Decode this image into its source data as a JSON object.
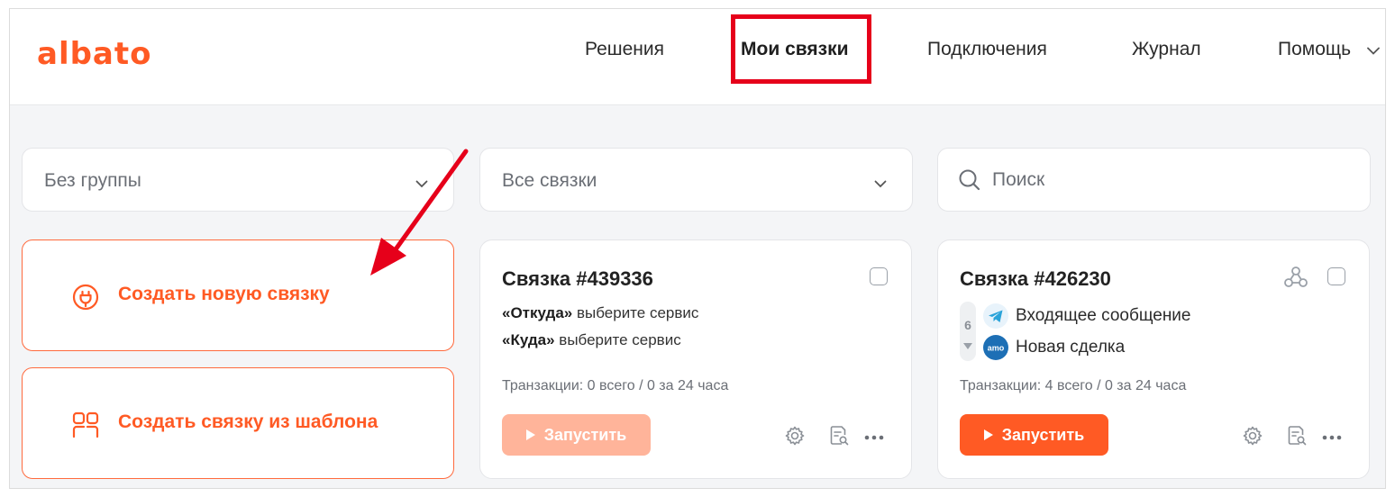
{
  "brand": {
    "logo_text": "albato",
    "accent_color": "#ff5a24",
    "highlight_color": "#e6001a"
  },
  "nav": {
    "solutions": "Решения",
    "my_links": "Мои связки",
    "connections": "Подключения",
    "journal": "Журнал",
    "help": "Помощь"
  },
  "filters": {
    "group_select": "Без группы",
    "links_select": "Все связки",
    "search_placeholder": "Поиск"
  },
  "actions": {
    "create_new": "Создать новую связку",
    "create_from_template": "Создать связку из шаблона"
  },
  "cards": [
    {
      "title": "Связка #439336",
      "from_label": "«Откуда»",
      "from_value": "выберите сервис",
      "to_label": "«Куда»",
      "to_value": "выберите сервис",
      "transactions": "Транзакции: 0 всего / 0 за 24 часа",
      "run_label": "Запустить",
      "run_enabled": false
    },
    {
      "title": "Связка #426230",
      "steps_count": "6",
      "trigger_service": "telegram-icon",
      "trigger_text": "Входящее сообщение",
      "action_service": "amocrm-icon",
      "action_text": "Новая сделка",
      "transactions": "Транзакции: 4 всего / 0 за 24 часа",
      "run_label": "Запустить",
      "run_enabled": true
    }
  ]
}
